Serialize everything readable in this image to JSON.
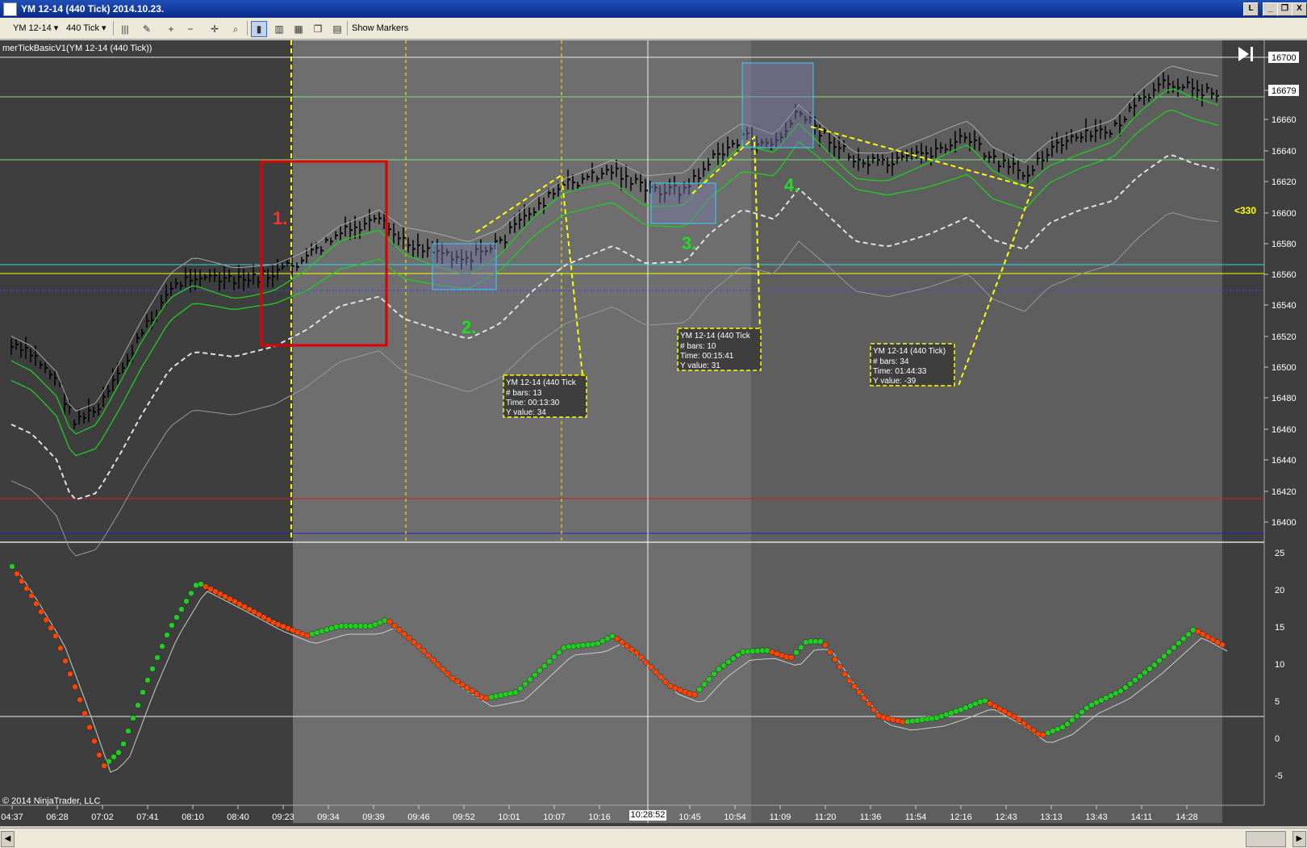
{
  "window": {
    "title": "YM 12-14 (440 Tick)  2014.10.23.",
    "buttons": [
      "L",
      "_",
      "❐",
      "X"
    ]
  },
  "toolbar": {
    "instrument": "YM 12-14",
    "period": "440 Tick",
    "show_markers": "Show Markers"
  },
  "indicator_label": "merTickBasicV1(YM 12-14 (440 Tick))",
  "copyright": "© 2014 NinjaTrader, LLC",
  "price_axis": [
    "16700",
    "16679",
    "16660",
    "16640",
    "16620",
    "16600",
    "16580",
    "16560",
    "16540",
    "16520",
    "16500",
    "16480",
    "16460",
    "16440",
    "16420",
    "16400"
  ],
  "oscillator_axis": [
    "25",
    "20",
    "15",
    "10",
    "5",
    "0",
    "-5"
  ],
  "time_axis": [
    "04:37",
    "06:28",
    "07:02",
    "07:41",
    "08:10",
    "08:40",
    "09:23",
    "09:34",
    "09:39",
    "09:46",
    "09:52",
    "10:01",
    "10:07",
    "10:16",
    "10:45",
    "10:54",
    "11:09",
    "11:20",
    "11:36",
    "11:54",
    "12:16",
    "12:43",
    "13:13",
    "13:43",
    "14:11",
    "14:28"
  ],
  "cursor_time": "10:28:52",
  "marker_330": "<330",
  "annotations": {
    "a1": "1.",
    "a2": "2.",
    "a3": "3.",
    "a4": "4."
  },
  "info_boxes": [
    {
      "title": "YM 12-14 (440 Tick",
      "bars": "# bars:   13",
      "time": "Time:    00:13:30",
      "yvalue": "Y value: 34"
    },
    {
      "title": "YM 12-14 (440 Tick",
      "bars": "# bars:   10",
      "time": "Time:    00:15:41",
      "yvalue": "Y value: 31"
    },
    {
      "title": "YM 12-14 (440 Tick)",
      "bars": "# bars:   34",
      "time": "Time:    01:44:33",
      "yvalue": "Y value: -39"
    }
  ],
  "colors": {
    "background": "#3e3e3e",
    "session_band": "#6e6e6e",
    "bull_dot": "#22cc22",
    "bear_dot": "#ff4400",
    "highlight_box": "#e00000",
    "annotation_yellow": "#ffff00"
  }
}
